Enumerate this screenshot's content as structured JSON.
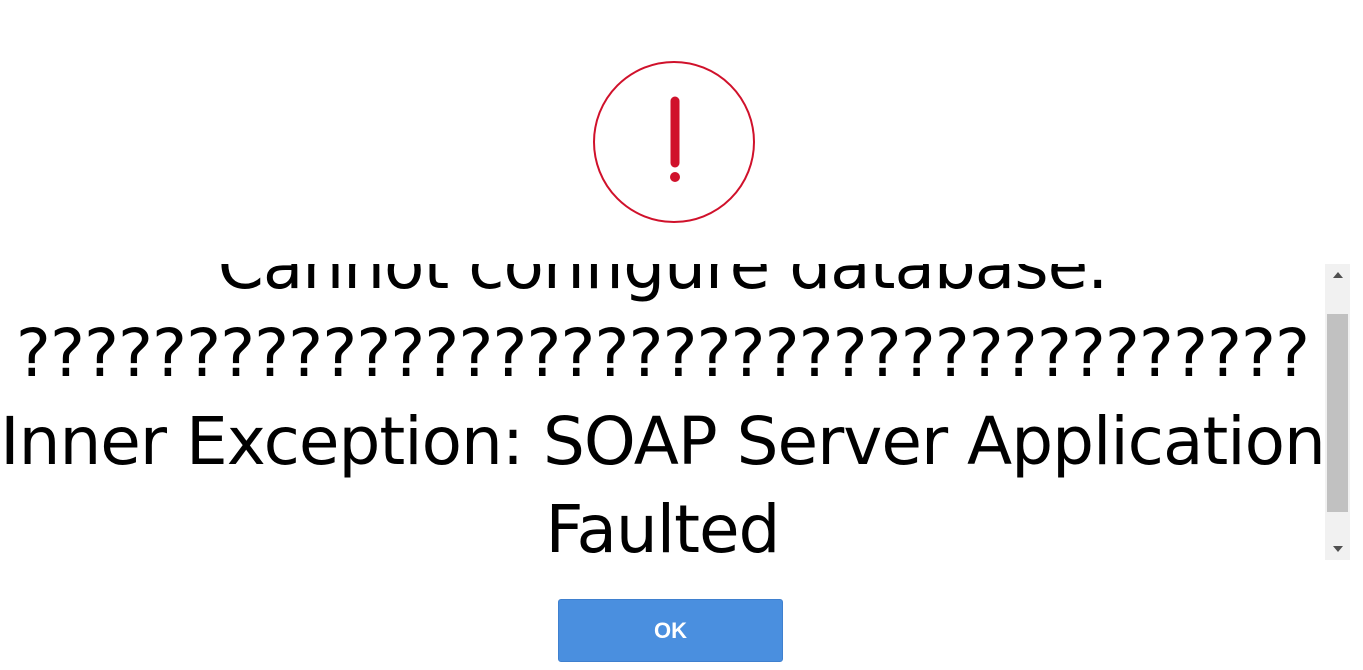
{
  "alert": {
    "icon": "exclamation-circle-icon",
    "color": "#d0112b"
  },
  "message": {
    "lines": [
      "Cannot configure database.",
      "??????????????????????????????????????",
      "Inner Exception: SOAP Server Application",
      "Faulted"
    ]
  },
  "scrollbar": {
    "up_icon": "scroll-up-arrow-icon",
    "down_icon": "scroll-down-arrow-icon"
  },
  "buttons": {
    "ok_label": "OK",
    "ok_color": "#4a8fdf"
  }
}
